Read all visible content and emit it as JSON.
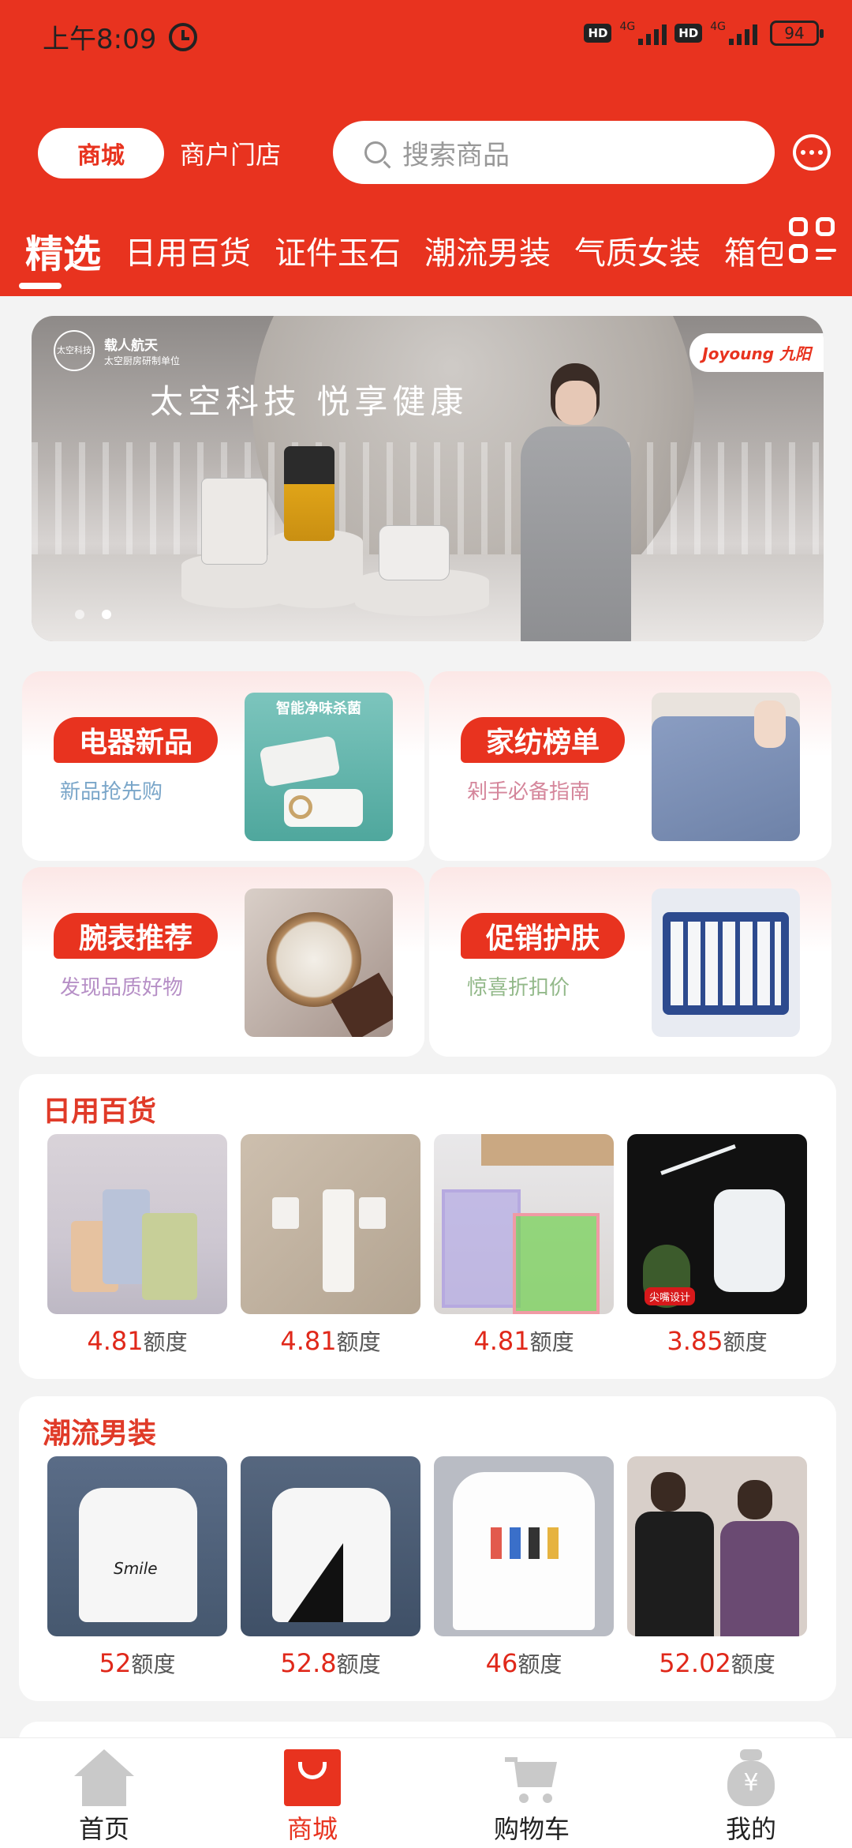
{
  "status_bar": {
    "time": "上午8:09",
    "hd": "HD",
    "net": "4G",
    "battery": "94"
  },
  "header": {
    "segment_active": "商城",
    "segment_other": "商户门店",
    "search_placeholder": "搜索商品",
    "tabs": [
      "精选",
      "日用百货",
      "证件玉石",
      "潮流男装",
      "气质女装",
      "箱包"
    ]
  },
  "banner": {
    "badge_text": "太空科技",
    "tag_line1": "载人航天",
    "tag_line2": "太空厨房研制单位",
    "headline": "太空科技  悦享健康",
    "brand": "Joyoung 九阳"
  },
  "features": [
    {
      "title": "电器新品",
      "subtitle": "新品抢先购",
      "sub_color": "#7aa6c9",
      "img_text": "智能净味杀菌"
    },
    {
      "title": "家纺榜单",
      "subtitle": "剁手必备指南",
      "sub_color": "#d5869b"
    },
    {
      "title": "腕表推荐",
      "subtitle": "发现品质好物",
      "sub_color": "#b68fc6"
    },
    {
      "title": "促销护肤",
      "subtitle": "惊喜折扣价",
      "sub_color": "#93b98a"
    }
  ],
  "sections": [
    {
      "title": "日用百货",
      "unit": "额度",
      "items": [
        {
          "price": "4.81",
          "icon": "cups-image"
        },
        {
          "price": "4.81",
          "icon": "hooks-image"
        },
        {
          "price": "4.81",
          "icon": "bag-holder-image"
        },
        {
          "price": "3.85",
          "icon": "wash-bottle-image",
          "badge": "尖嘴设计"
        }
      ]
    },
    {
      "title": "潮流男装",
      "unit": "额度",
      "items": [
        {
          "price": "52",
          "icon": "smile-tee-image",
          "print": "Smile"
        },
        {
          "price": "52.8",
          "icon": "plane-tee-image"
        },
        {
          "price": "46",
          "icon": "figures-tee-image"
        },
        {
          "price": "52.02",
          "icon": "couple-tee-image"
        }
      ]
    }
  ],
  "bottom_nav": [
    {
      "label": "首页",
      "icon": "home-icon",
      "active": false
    },
    {
      "label": "商城",
      "icon": "shop-bag-icon",
      "active": true
    },
    {
      "label": "购物车",
      "icon": "cart-icon",
      "active": false
    },
    {
      "label": "我的",
      "icon": "money-bag-icon",
      "active": false
    }
  ],
  "colors": {
    "brand_red": "#e8331f",
    "price_red": "#e0281a",
    "background": "#f3f3f3"
  }
}
